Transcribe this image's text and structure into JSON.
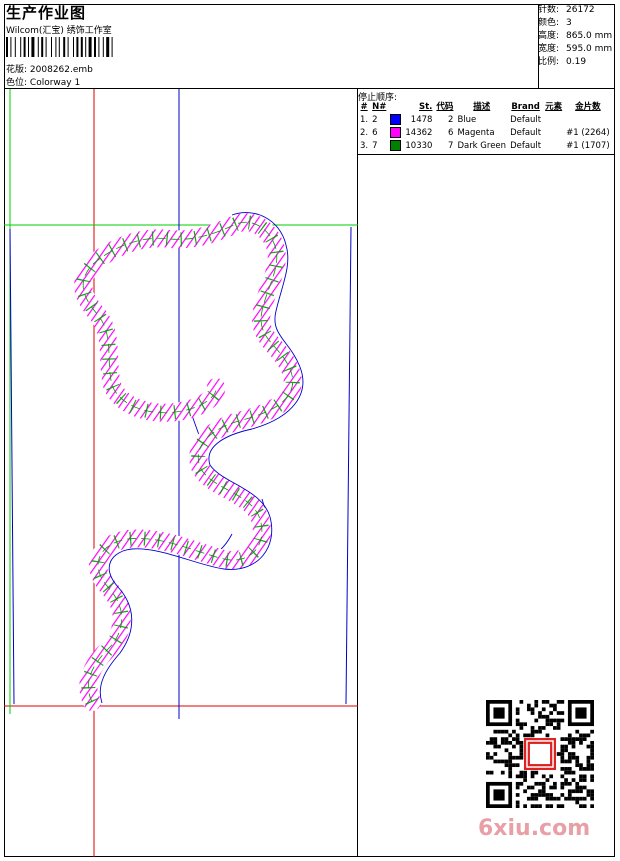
{
  "header": {
    "title": "生产作业图",
    "subtitle": "Wilcom(汇宝) 绣饰工作室",
    "design_label": "花版:",
    "design_value": "2008262.emb",
    "colorway_label": "色位:",
    "colorway_value": "Colorway 1"
  },
  "stats": [
    {
      "label": "针数:",
      "value": "26172"
    },
    {
      "label": "颜色:",
      "value": "3"
    },
    {
      "label": "高度:",
      "value": "865.0 mm"
    },
    {
      "label": "宽度:",
      "value": "595.0 mm"
    },
    {
      "label": "比例:",
      "value": "0.19"
    }
  ],
  "sequence": {
    "title": "停止顺序:",
    "headers": {
      "num": "#",
      "needle": "N#",
      "stitches": "St.",
      "code": "代码",
      "desc": "描述",
      "brand": "Brand",
      "element": "元素",
      "sequin": "金片数"
    },
    "rows": [
      {
        "num": "1.",
        "needle": "2",
        "color": "#0000ff",
        "stitches": "1478",
        "code": "2",
        "desc": "Blue",
        "brand": "Default",
        "sequin": ""
      },
      {
        "num": "2.",
        "needle": "6",
        "color": "#ff00ff",
        "stitches": "14362",
        "code": "6",
        "desc": "Magenta",
        "brand": "Default",
        "sequin": "#1 (2264)"
      },
      {
        "num": "3.",
        "needle": "7",
        "color": "#008000",
        "stitches": "10330",
        "code": "7",
        "desc": "Dark Green",
        "brand": "Default",
        "sequin": "#1 (1707)"
      }
    ]
  },
  "watermark": "6xiu.com",
  "colors": {
    "guide_red": "#e00000",
    "guide_green": "#00cc00",
    "outline_blue": "#0000cc",
    "fill_magenta": "#ff00ff",
    "stitch_green": "#009900"
  }
}
